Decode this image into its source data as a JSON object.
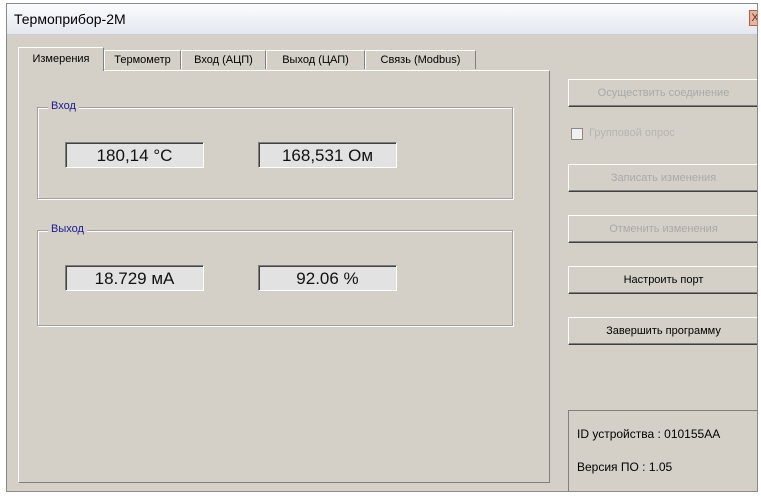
{
  "window": {
    "title": "Термоприбор-2М",
    "close_label": "X"
  },
  "tabs": [
    {
      "label": "Измерения"
    },
    {
      "label": "Термометр"
    },
    {
      "label": "Вход (АЦП)"
    },
    {
      "label": "Выход (ЦАП)"
    },
    {
      "label": "Связь (Modbus)"
    }
  ],
  "input_group": {
    "legend": "Вход",
    "temperature": "180,14 °С",
    "resistance": "168,531 Ом"
  },
  "output_group": {
    "legend": "Выход",
    "current": "18.729 мА",
    "percent": "92.06 %"
  },
  "buttons": {
    "connect": "Осуществить соединение",
    "group_poll": "Групповой опрос",
    "write_changes": "Записать изменения",
    "cancel_changes": "Отменить изменения",
    "configure_port": "Настроить порт",
    "exit": "Завершить программу"
  },
  "device_info": {
    "id_line": "ID устройства : 010155AA",
    "version_line": "Версия ПО : 1.05"
  }
}
